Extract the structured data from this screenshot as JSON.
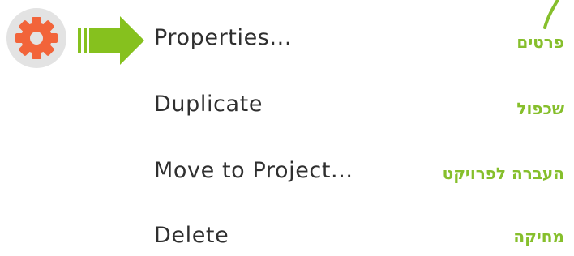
{
  "context_menu": {
    "items": [
      {
        "label": "Properties..."
      },
      {
        "label": "Duplicate"
      },
      {
        "label": "Move to Project..."
      },
      {
        "label": "Delete"
      }
    ]
  },
  "annotations": {
    "items": [
      {
        "text": "פרטים"
      },
      {
        "text": "שכפול"
      },
      {
        "text": "העברה לפרויקט"
      },
      {
        "text": "מחיקה"
      }
    ]
  },
  "icons": {
    "gear": "gear-icon",
    "arrow": "arrow-right-icon"
  },
  "colors": {
    "gear": "#f2643a",
    "gear_badge": "#e3e3e3",
    "arrow": "#86c11e",
    "annotation_text": "#86bf2c",
    "menu_text": "#2f2f2f"
  }
}
